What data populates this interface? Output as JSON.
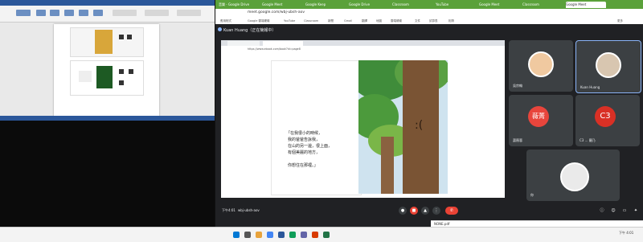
{
  "word": {
    "visible": true
  },
  "chrome": {
    "tabs": [
      {
        "label": "音樂 - Google Drive"
      },
      {
        "label": "Google Meet"
      },
      {
        "label": "Google Keep"
      },
      {
        "label": "Google Drive"
      },
      {
        "label": "Classroom"
      },
      {
        "label": "YouTube"
      },
      {
        "label": "Google Meet"
      },
      {
        "label": "Classroom"
      },
      {
        "label": "Google Meet"
      }
    ],
    "url": "meet.google.com/wbj-ubsh-aov",
    "bookmarks": [
      "應用程式",
      "Google 雲端硬碟",
      "YouTube",
      "Classroom",
      "新聞",
      "Gmail",
      "翻譯",
      "地圖",
      "雲端硬碟",
      "文件",
      "試算表",
      "相簿",
      "更多"
    ]
  },
  "meet": {
    "presenter_title": "Kuan Huang（正在簡報中）",
    "shared_url": "https://www.ebook.com/book?id=page8",
    "story_lines": [
      "「在我很小的時候，",
      "我的爸爸告訴我，",
      "在山的另一邊，很上面，",
      "有個美麗的地方，",
      "",
      "你想住在那裡。」"
    ],
    "participants": [
      {
        "name": "吳宗翰",
        "initial": ""
      },
      {
        "name": "Kuan Huang",
        "initial": ""
      },
      {
        "name": "蕭薇蓉",
        "initial": "薇菁",
        "color": "#e8453c"
      },
      {
        "name": "C3 ... 羅乃",
        "initial": "C3",
        "color": "#d93025"
      },
      {
        "name": "你",
        "initial": ""
      }
    ],
    "meeting_code": "wbj-ubsh-aov",
    "time": "下午4:01"
  },
  "download": {
    "file": "NONE.pdf"
  },
  "taskbar": {
    "time": "下午 4:01"
  }
}
